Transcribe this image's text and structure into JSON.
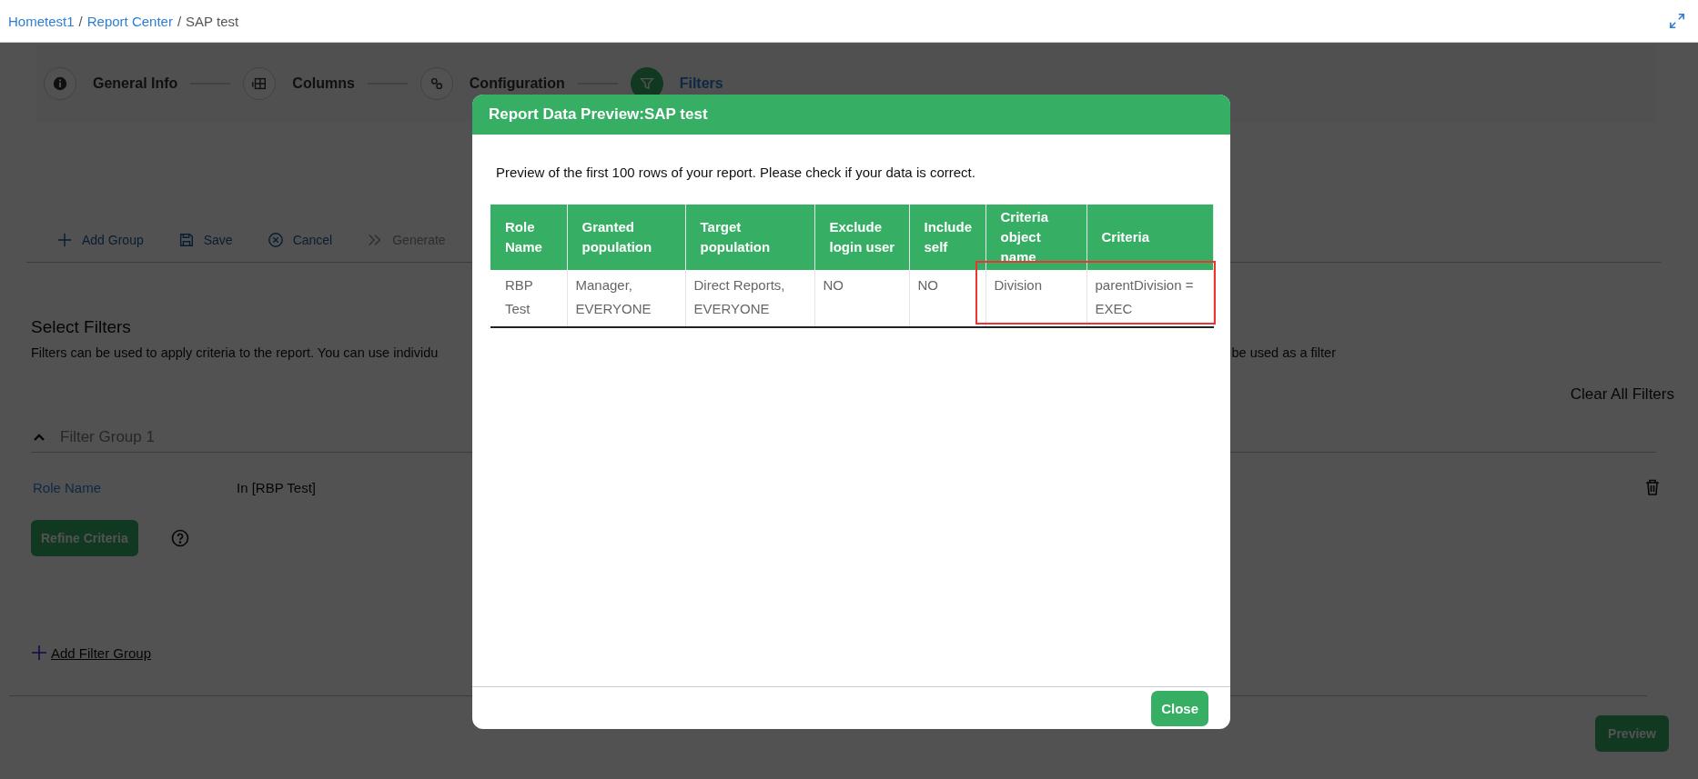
{
  "breadcrumb": {
    "separator": "/",
    "items": [
      {
        "label": "Hometest1",
        "link": true
      },
      {
        "label": "Report Center",
        "link": true
      },
      {
        "label": "SAP test",
        "link": false
      }
    ]
  },
  "steps": [
    {
      "label": "General Info",
      "selected": false
    },
    {
      "label": "Columns",
      "selected": false
    },
    {
      "label": "Configuration",
      "selected": false
    },
    {
      "label": "Filters",
      "selected": true
    }
  ],
  "toolbar": [
    {
      "label": "Add Group",
      "disabled": false
    },
    {
      "label": "Save",
      "disabled": false
    },
    {
      "label": "Cancel",
      "disabled": false
    },
    {
      "label": "Generate",
      "disabled": true
    }
  ],
  "select_filters": {
    "title": "Select Filters",
    "description_start": "Filters can be used to apply criteria to the report. You can use individu",
    "description_end": "be used as a filter",
    "clear_all": "Clear All Filters"
  },
  "filter_groups": [
    {
      "title": "Filter Group 1",
      "expanded": true,
      "rows": [
        {
          "field": "Role Name",
          "value": "In [RBP Test]"
        }
      ],
      "refine_button": "Refine Criteria"
    }
  ],
  "add_filter_group": "Add Filter Group",
  "preview_button": "Preview",
  "dialog": {
    "title": "Report Data Preview:SAP test",
    "intro": "Preview of the first 100 rows of your report. Please check if your data is correct.",
    "columns": [
      "Role Name",
      "Granted population",
      "Target population",
      "Exclude login user",
      "Include self",
      "Criteria object name",
      "Criteria"
    ],
    "rows": [
      [
        "RBP Test",
        "Manager, EVERYONE",
        "Direct Reports, EVERYONE",
        "NO",
        "NO",
        "Division",
        "parentDivision = EXEC"
      ]
    ],
    "close_button": "Close"
  }
}
